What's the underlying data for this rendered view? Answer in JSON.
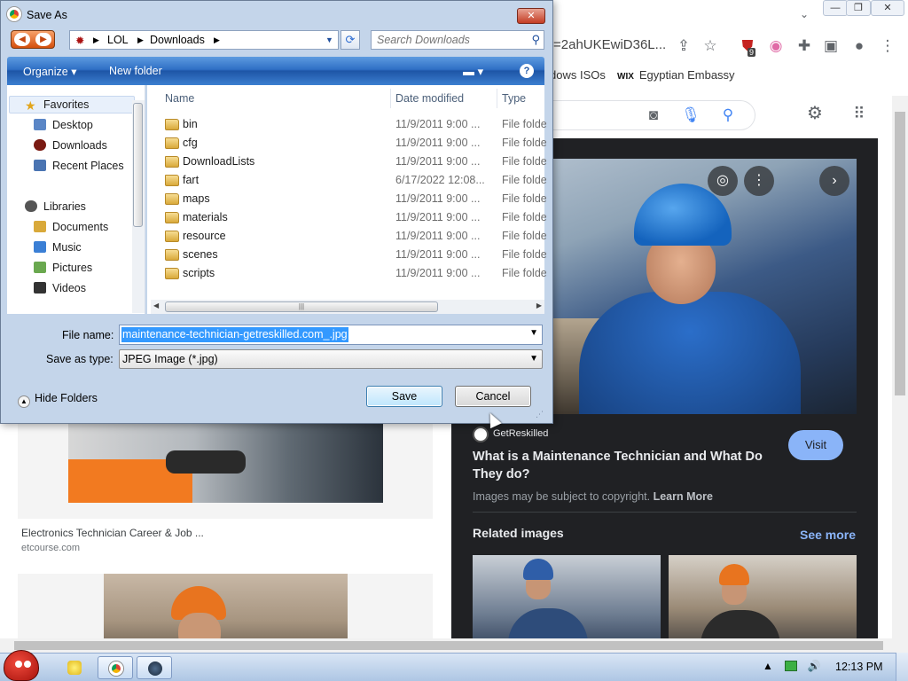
{
  "browser": {
    "url_fragment": "=2ahUKEwiD36L...",
    "bookmarks": [
      "dows ISOs",
      "Egyptian Embassy"
    ],
    "bookmark_wix_label": "WIX",
    "extension_badge": "9",
    "preview": {
      "source": "GetReskilled",
      "visit_label": "Visit",
      "title": "What is a Maintenance Technician and What Do They do?",
      "copyright_text": "Images may be subject to copyright.",
      "learn_more": "Learn More",
      "related_label": "Related images",
      "see_more": "See more"
    },
    "results": [
      {
        "title": "Electronics Technician Career & Job ...",
        "source": "etcourse.com"
      }
    ]
  },
  "dialog": {
    "title": "Save As",
    "close_label": "✕",
    "breadcrumb": [
      "LOL",
      "Downloads"
    ],
    "search_placeholder": "Search Downloads",
    "toolbar": {
      "organize": "Organize ▾",
      "new_folder": "New folder",
      "help": "?"
    },
    "nav": {
      "favorites_label": "Favorites",
      "favorites": [
        "Desktop",
        "Downloads",
        "Recent Places"
      ],
      "libraries_label": "Libraries",
      "libraries": [
        "Documents",
        "Music",
        "Pictures",
        "Videos"
      ]
    },
    "columns": {
      "name": "Name",
      "date": "Date modified",
      "type": "Type"
    },
    "files": [
      {
        "name": "bin",
        "date": "11/9/2011 9:00 ...",
        "type": "File folder"
      },
      {
        "name": "cfg",
        "date": "11/9/2011 9:00 ...",
        "type": "File folder"
      },
      {
        "name": "DownloadLists",
        "date": "11/9/2011 9:00 ...",
        "type": "File folder"
      },
      {
        "name": "fart",
        "date": "6/17/2022 12:08...",
        "type": "File folder"
      },
      {
        "name": "maps",
        "date": "11/9/2011 9:00 ...",
        "type": "File folder"
      },
      {
        "name": "materials",
        "date": "11/9/2011 9:00 ...",
        "type": "File folder"
      },
      {
        "name": "resource",
        "date": "11/9/2011 9:00 ...",
        "type": "File folder"
      },
      {
        "name": "scenes",
        "date": "11/9/2011 9:00 ...",
        "type": "File folder"
      },
      {
        "name": "scripts",
        "date": "11/9/2011 9:00 ...",
        "type": "File folder"
      }
    ],
    "file_name_label": "File name:",
    "file_name_value": "maintenance-technician-getreskilled.com_.jpg",
    "save_type_label": "Save as type:",
    "save_type_value": "JPEG Image (*.jpg)",
    "hide_folders": "Hide Folders",
    "save_label": "Save",
    "cancel_label": "Cancel"
  },
  "taskbar": {
    "clock": "12:13 PM"
  },
  "colors": {
    "accent_blue": "#8ab4f8",
    "dark_panel": "#202124",
    "dialog_toolbar": "#2f6fc4",
    "selection": "#3399ff"
  }
}
